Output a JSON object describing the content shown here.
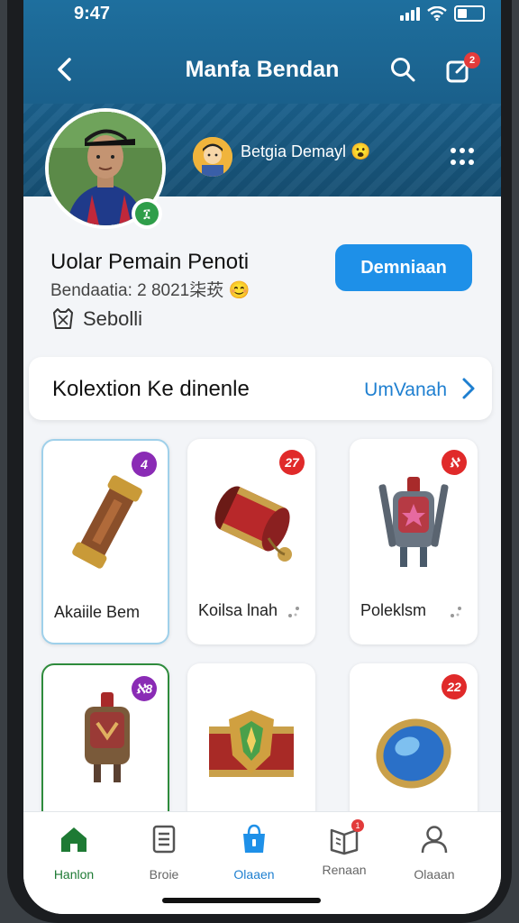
{
  "status_bar": {
    "time": "9:47"
  },
  "header": {
    "title": "Manfa Bendan",
    "notification_count": "2"
  },
  "profile": {
    "friend_name": "Betgia Demayl",
    "friend_emoji": "😮",
    "name": "Uolar Pemain Penoti",
    "meta": "Bendaatia: 2 8021",
    "meta_symbols": "柒莰",
    "meta_emoji": "😊",
    "status": "Sebolli",
    "badge_text": "፲",
    "action_label": "Demniaan"
  },
  "collection": {
    "title": "Kolextion Ke dinenle",
    "link_label": "UmVanah",
    "items": [
      {
        "name": "Akaiile Bem",
        "badge": "4",
        "badge_color": "#8a2bb5"
      },
      {
        "name": "Koilsa lnah",
        "badge": "27",
        "badge_color": "#e02a2a"
      },
      {
        "name": "Poleklsm",
        "badge": "ℵ",
        "badge_color": "#e02a2a"
      },
      {
        "name": "",
        "badge": "ℵ8",
        "badge_color": "#8a2bb5"
      },
      {
        "name": "",
        "badge": "",
        "badge_color": "#ffffff"
      },
      {
        "name": "",
        "badge": "22",
        "badge_color": "#e02a2a"
      }
    ]
  },
  "tabs": [
    {
      "label": "Hanlon"
    },
    {
      "label": "Broie"
    },
    {
      "label": "Olaaen"
    },
    {
      "label": "Renaan",
      "badge": "1"
    },
    {
      "label": "Olaaan"
    }
  ],
  "colors": {
    "accent": "#1e90e8",
    "header": "#1a5f8a",
    "home_green": "#1e7a34"
  }
}
